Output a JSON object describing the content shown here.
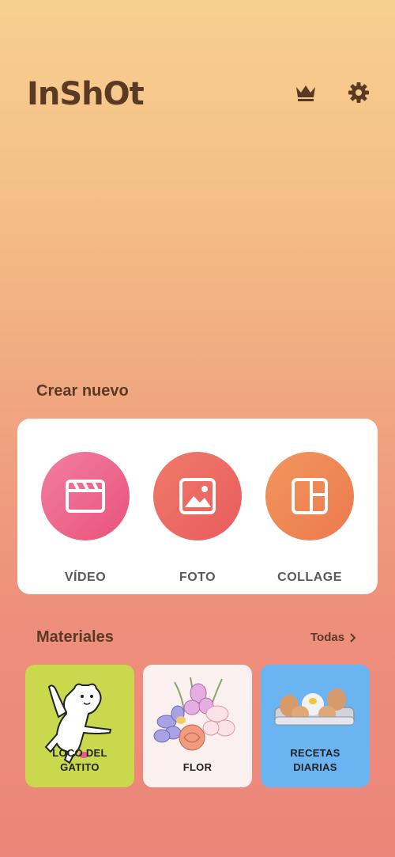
{
  "header": {
    "logo": "InShOt"
  },
  "create": {
    "title": "Crear nuevo",
    "items": [
      {
        "label": "VÍDEO"
      },
      {
        "label": "FOTO"
      },
      {
        "label": "COLLAGE"
      }
    ]
  },
  "materials": {
    "title": "Materiales",
    "see_all": "Todas",
    "items": [
      {
        "label_line1": "LOCO DEL",
        "label_line2": "GATITO"
      },
      {
        "label_line1": "FLOR",
        "label_line2": ""
      },
      {
        "label_line1": "RECETAS",
        "label_line2": "DIARIAS"
      }
    ]
  }
}
